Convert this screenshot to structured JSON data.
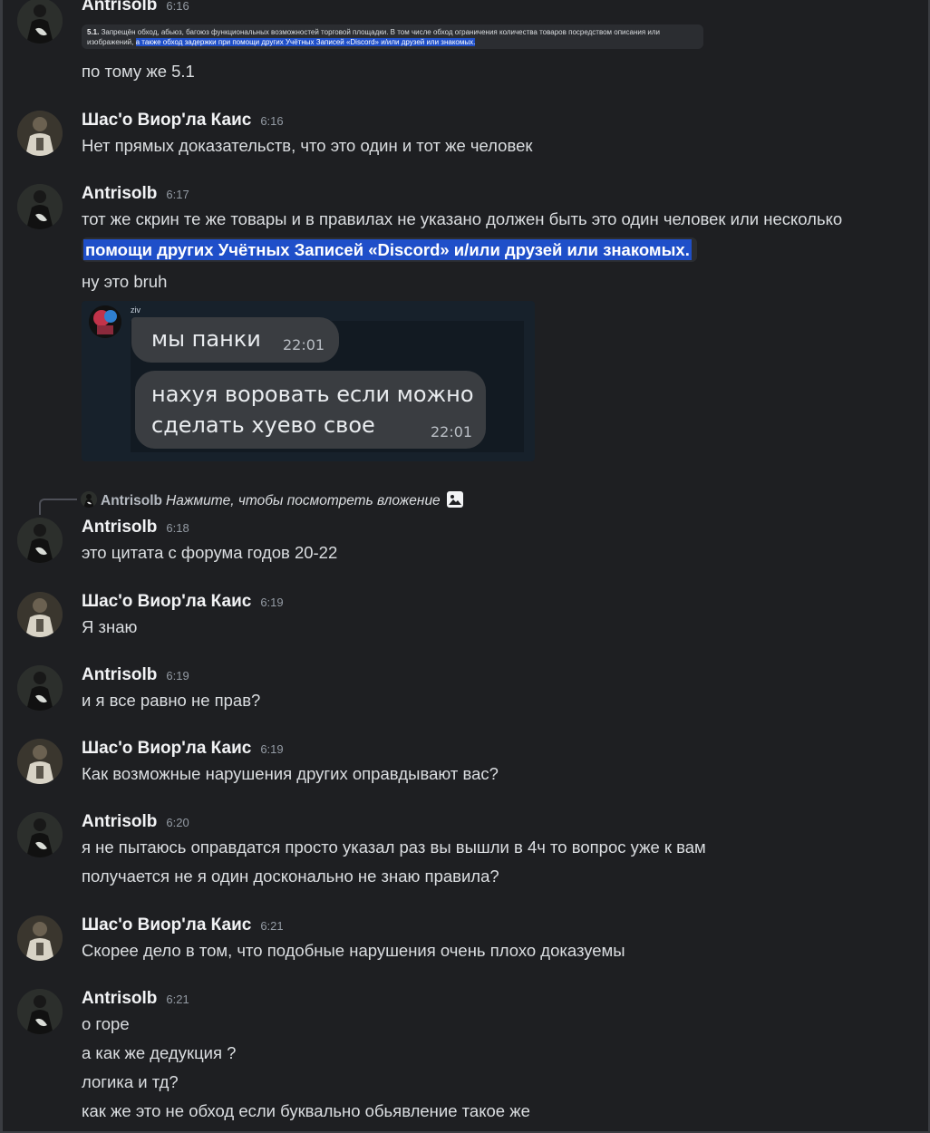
{
  "users": {
    "antrisolb": "Antrisolb",
    "shaso": "Шас'о Виор'ла Каис"
  },
  "rule_snippet": {
    "number": "5.1.",
    "text_plain": " Запрещён обход, абьюз, багоюз функциональных возможностей торговой площадки. В том числе обход ограничения количества товаров посредством описания или изображений, ",
    "text_highlight": "а также обход задержки при помощи других Учётных Записей «Discord» и/или друзей или знакомых."
  },
  "messages": [
    {
      "author": "Antrisolb",
      "time": "6:16",
      "lines": [
        "по тому же 5.1"
      ]
    },
    {
      "author": "Шас'о Виор'ла Каис",
      "time": "6:16",
      "lines": [
        "Нет прямых доказательств, что это один и тот же человек"
      ]
    },
    {
      "author": "Antrisolb",
      "time": "6:17",
      "lines": [
        "тот же скрин те же товары и в правилах не указано должен быть это один человек или несколько",
        "помощи других Учётных Записей «Discord» и/или друзей или знакомых.",
        "ну это bruh"
      ]
    },
    {
      "author": "Antrisolb",
      "time": "6:18",
      "lines": [
        "это цитата с форума годов 20-22"
      ]
    },
    {
      "author": "Шас'о Виор'ла Каис",
      "time": "6:19",
      "lines": [
        "Я знаю"
      ]
    },
    {
      "author": "Antrisolb",
      "time": "6:19",
      "lines": [
        "и я все равно не прав?"
      ]
    },
    {
      "author": "Шас'о Виор'ла Каис",
      "time": "6:19",
      "lines": [
        "Как возможные нарушения других оправдывают вас?"
      ]
    },
    {
      "author": "Antrisolb",
      "time": "6:20",
      "lines": [
        "я не пытаюсь оправдатся просто указал раз вы вышли в 4ч то вопрос уже к вам",
        "получается не я один досконально не знаю правила?"
      ]
    },
    {
      "author": "Шас'о Виор'ла Каис",
      "time": "6:21",
      "lines": [
        "Скорее дело в том, что подобные нарушения очень плохо доказуемы"
      ]
    },
    {
      "author": "Antrisolb",
      "time": "6:21",
      "lines": [
        "о  горе",
        "а как же дедукция ?",
        "логика и тд?",
        "как же это не обход если буквально обьявление такое же"
      ]
    }
  ],
  "embed": {
    "sender": "ziv",
    "bubble1": {
      "text": "мы панки",
      "time": "22:01"
    },
    "bubble2": {
      "line1": "нахуя воровать если можно",
      "line2": "сделать хуево свое",
      "time": "22:01"
    }
  },
  "reply": {
    "author": "Antrisolb",
    "text": "Нажмите, чтобы посмотреть вложение",
    "icon": "image-icon"
  }
}
